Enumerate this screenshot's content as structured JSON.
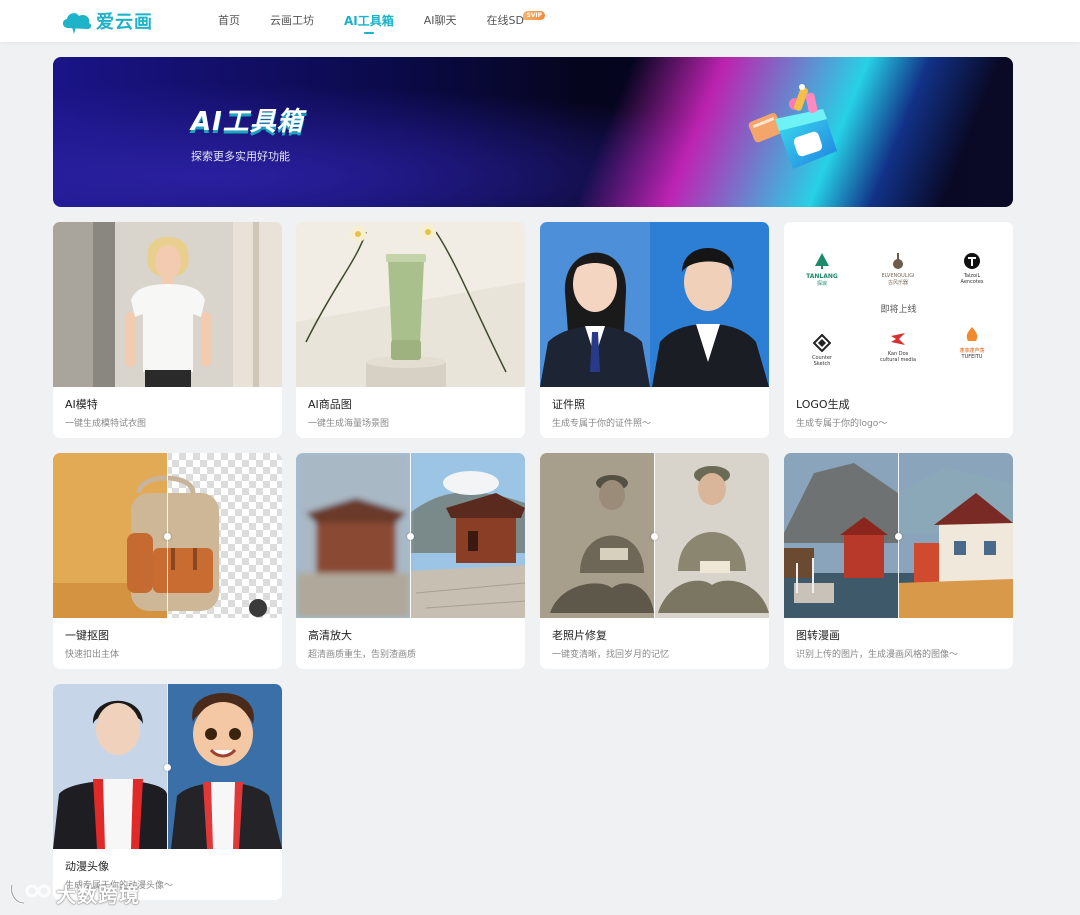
{
  "header": {
    "brand": "爱云画",
    "nav": [
      {
        "label": "首页",
        "active": false
      },
      {
        "label": "云画工坊",
        "active": false
      },
      {
        "label": "AI工具箱",
        "active": true
      },
      {
        "label": "AI聊天",
        "active": false
      },
      {
        "label": "在线SD",
        "active": false,
        "badge": "SVIP"
      }
    ]
  },
  "banner": {
    "title": "AI工具箱",
    "subtitle": "探索更多实用好功能"
  },
  "tools": [
    {
      "title": "AI模特",
      "desc": "一键生成模特试衣图",
      "icon": "model-photo"
    },
    {
      "title": "AI商品图",
      "desc": "一键生成海量场景图",
      "icon": "product-photo"
    },
    {
      "title": "证件照",
      "desc": "生成专属于你的证件照～",
      "icon": "id-photo"
    },
    {
      "title": "LOGO生成",
      "desc": "生成专属于你的logo～",
      "icon": "logo-samples",
      "overlay": "即将上线",
      "samples": [
        "TANLANG",
        "探浪",
        "ELVENOULIGI",
        "古风乐器",
        "TaizoiL",
        "Aencotes",
        "Counter",
        "Sketch",
        "Kan Dos",
        "cultural media",
        "蓬菲蓬芦荡",
        "TUFEITU"
      ]
    },
    {
      "title": "一键抠图",
      "desc": "快速扣出主体",
      "icon": "cutout-compare"
    },
    {
      "title": "高清放大",
      "desc": "超清画质重生，告别渣画质",
      "icon": "upscale-compare"
    },
    {
      "title": "老照片修复",
      "desc": "一键变清晰，找回岁月的记忆",
      "icon": "restore-compare"
    },
    {
      "title": "图转漫画",
      "desc": "识别上传的图片，生成漫画风格的图像～",
      "icon": "comic-compare"
    },
    {
      "title": "动漫头像",
      "desc": "生成专属于你的动漫头像～",
      "icon": "anime-compare"
    }
  ],
  "watermark": {
    "text": "大数跨境"
  },
  "colors": {
    "accent": "#19b2c8",
    "page_bg": "#f0f1f3"
  }
}
